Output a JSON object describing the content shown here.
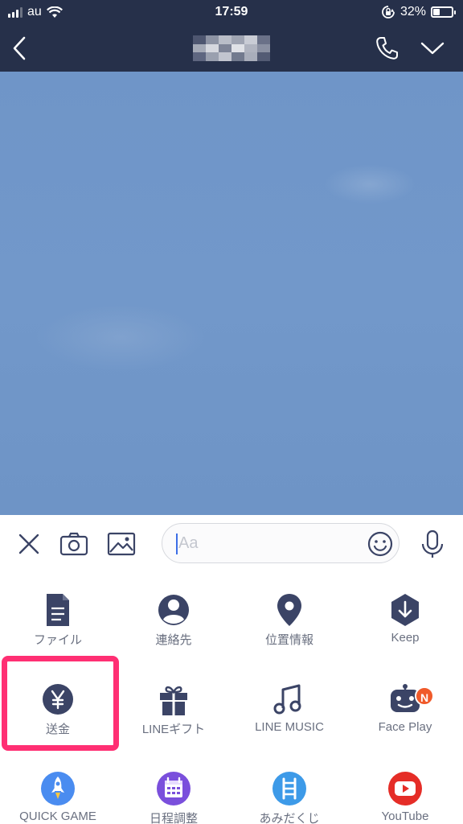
{
  "status_bar": {
    "carrier": "au",
    "time": "17:59",
    "battery_percent": "32%",
    "battery_level": 0.32
  },
  "input": {
    "placeholder": "Aa"
  },
  "menu": {
    "items": [
      {
        "label": "ファイル",
        "icon": "file-icon"
      },
      {
        "label": "連絡先",
        "icon": "contact-icon"
      },
      {
        "label": "位置情報",
        "icon": "location-pin-icon"
      },
      {
        "label": "Keep",
        "icon": "keep-icon"
      },
      {
        "label": "送金",
        "icon": "yen-icon"
      },
      {
        "label": "LINEギフト",
        "icon": "gift-icon"
      },
      {
        "label": "LINE MUSIC",
        "icon": "music-note-icon"
      },
      {
        "label": "Face Play",
        "icon": "face-play-icon",
        "badge": "N"
      },
      {
        "label": "QUICK GAME",
        "icon": "rocket-icon"
      },
      {
        "label": "日程調整",
        "icon": "calendar-icon"
      },
      {
        "label": "あみだくじ",
        "icon": "ladder-icon"
      },
      {
        "label": "YouTube",
        "icon": "youtube-icon"
      }
    ]
  },
  "colors": {
    "header": "#26304a",
    "icon": "#3b4466",
    "label": "#6a7080",
    "highlight": "#ff2f73",
    "badge": "#f05a2a",
    "chat_bg": "#7198ca"
  }
}
